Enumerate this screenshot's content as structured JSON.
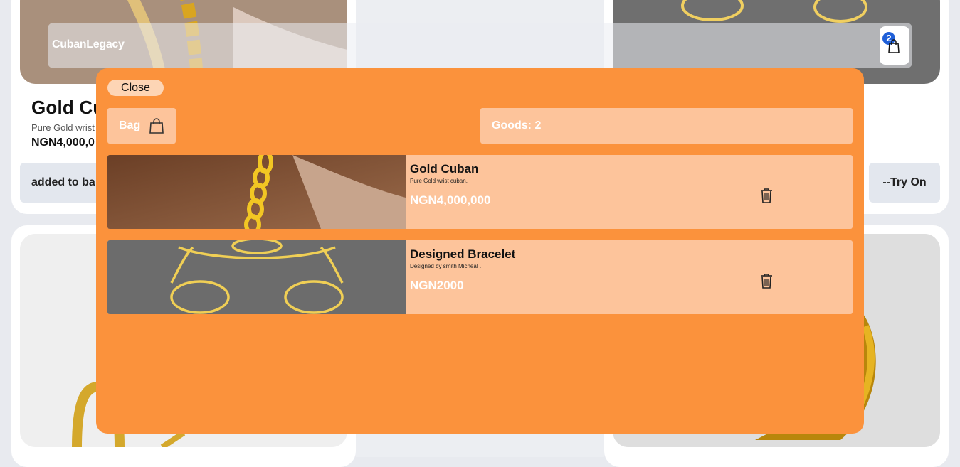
{
  "header": {
    "brand": "CubanLegacy",
    "bag_count": "2"
  },
  "background_card": {
    "title": "Gold Cub",
    "description": "Pure Gold wrist c",
    "price": "NGN4,000,0",
    "added_label": "added to ba",
    "try_on_label": "--Try On"
  },
  "modal": {
    "close_label": "Close",
    "bag_label": "Bag",
    "goods_label": "Goods: 2",
    "items": [
      {
        "name": "Gold Cuban",
        "description": "Pure Gold wrist cuban.",
        "price": "NGN4,000,000"
      },
      {
        "name": "Designed Bracelet",
        "description": "Designed by smith Micheal .",
        "price": "NGN2000"
      }
    ]
  },
  "colors": {
    "modal_bg": "#fb923c",
    "panel_bg": "#fdc49b",
    "badge": "#1f5fd8"
  },
  "icons": [
    "shopping-bag-icon",
    "trash-icon"
  ]
}
